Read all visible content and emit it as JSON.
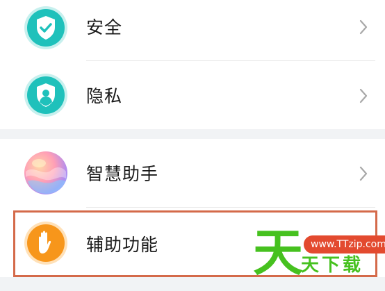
{
  "settings": {
    "items": [
      {
        "label": "安全",
        "icon": "shield-check-icon"
      },
      {
        "label": "隐私",
        "icon": "privacy-shield-icon"
      },
      {
        "label": "智慧助手",
        "icon": "smart-assistant-icon"
      },
      {
        "label": "辅助功能",
        "icon": "hand-icon"
      }
    ]
  },
  "watermark": {
    "logo_char": "天",
    "url": "www.TTzip.com",
    "text": "天下载"
  },
  "colors": {
    "teal": "#1fc1bb",
    "orange": "#f7961b",
    "highlight": "#d46a4a",
    "watermark_green": "#46c11f",
    "watermark_red": "#e34a2f"
  }
}
